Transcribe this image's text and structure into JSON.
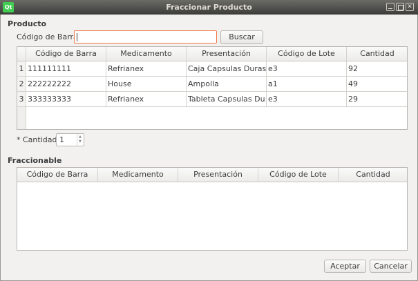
{
  "window": {
    "title": "Fraccionar Producto",
    "logo_text": "Qt",
    "controls": [
      "minimize-icon",
      "maximize-icon",
      "close-icon"
    ]
  },
  "producto": {
    "section_title": "Producto",
    "barcode_label": "Código de Barra",
    "barcode_value": "",
    "search_button": "Buscar",
    "table": {
      "columns": [
        "Código de Barra",
        "Medicamento",
        "Presentación",
        "Código de Lote",
        "Cantidad"
      ],
      "rows": [
        {
          "num": "1",
          "codigo": "111111111",
          "medicamento": "Refrianex",
          "presentacion": "Caja Capsulas Duras",
          "lote": "e3",
          "cantidad": "92"
        },
        {
          "num": "2",
          "codigo": "222222222",
          "medicamento": "House",
          "presentacion": "Ampolla",
          "lote": "a1",
          "cantidad": "49"
        },
        {
          "num": "3",
          "codigo": "333333333",
          "medicamento": "Refrianex",
          "presentacion": "Tableta Capsulas Du…",
          "lote": "e3",
          "cantidad": "29"
        }
      ]
    },
    "cantidad_label": "* Cantidad",
    "cantidad_value": "1"
  },
  "fraccionable": {
    "section_title": "Fraccionable",
    "table": {
      "columns": [
        "Código de Barra",
        "Medicamento",
        "Presentación",
        "Código de Lote",
        "Cantidad"
      ],
      "rows": []
    }
  },
  "buttons": {
    "accept": "Aceptar",
    "cancel": "Cancelar"
  },
  "colors": {
    "focus_border": "#f07746",
    "qt_logo": "#41cd52",
    "titlebar": "#4a4a46"
  }
}
